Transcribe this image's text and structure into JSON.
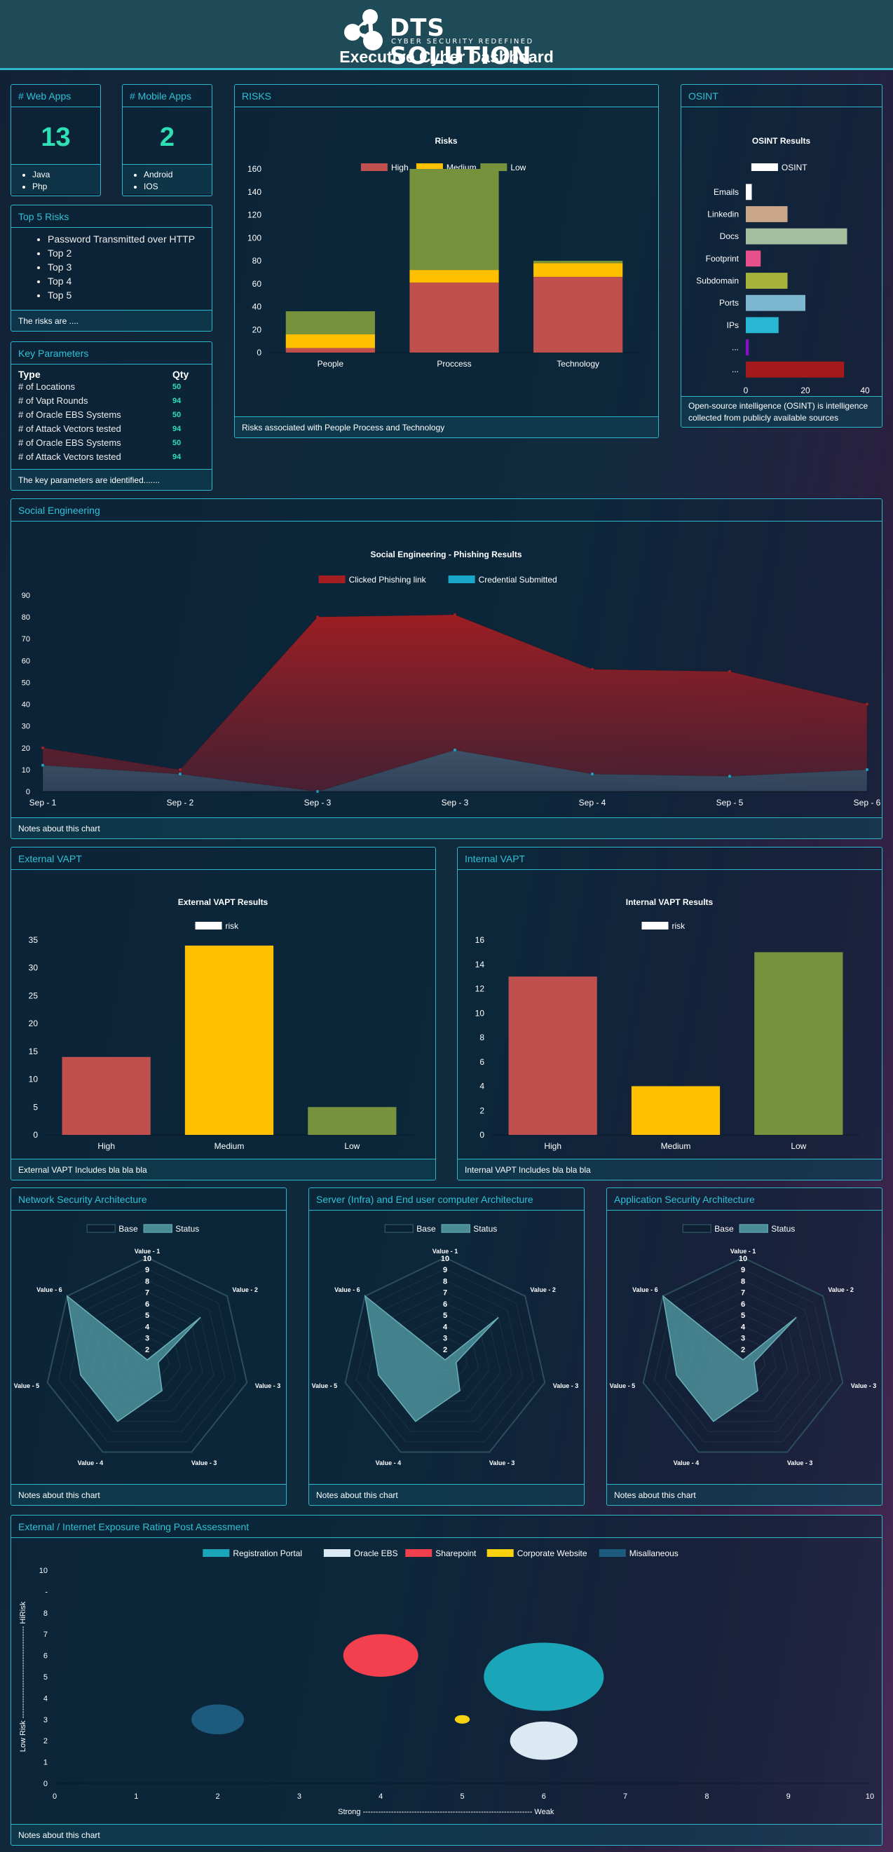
{
  "header": {
    "brand": "DTS SOLUTION",
    "tagline": "CYBER SECURITY REDEFINED",
    "title": "Executive Cyber Dashboard"
  },
  "web_apps": {
    "title": "# Web Apps",
    "count": "13",
    "items": [
      "Java",
      "Php"
    ]
  },
  "mobile_apps": {
    "title": "# Mobile Apps",
    "count": "2",
    "items": [
      "Android",
      "IOS"
    ]
  },
  "top_risks": {
    "title": "Top 5 Risks",
    "items": [
      "Password Transmitted over HTTP",
      "Top 2",
      "Top 3",
      "Top 4",
      "Top 5"
    ],
    "footer": "The risks are ...."
  },
  "key_parameters": {
    "title": "Key Parameters",
    "columns": [
      "Type",
      "Qty"
    ],
    "rows": [
      {
        "type": "# of Locations",
        "qty": "50"
      },
      {
        "type": "# of Vapt Rounds",
        "qty": "94"
      },
      {
        "type": "# of Oracle EBS Systems",
        "qty": "50"
      },
      {
        "type": "# of Attack Vectors tested",
        "qty": "94"
      },
      {
        "type": "# of Oracle EBS Systems",
        "qty": "50"
      },
      {
        "type": "# of Attack Vectors tested",
        "qty": "94"
      }
    ],
    "footer": "The key parameters are identified......."
  },
  "panels": {
    "risks": {
      "title": "RISKS",
      "footer": "Risks associated with People Process and Technology"
    },
    "osint": {
      "title": "OSINT",
      "footer_lines": [
        "Open-source intelligence (OSINT) is intelligence",
        "collected from publicly available sources"
      ]
    },
    "social": {
      "title": "Social Engineering",
      "footer": "Notes about this chart"
    },
    "ext_vapt": {
      "title": "External VAPT",
      "footer": "External VAPT Includes bla bla bla"
    },
    "int_vapt": {
      "title": "Internal VAPT",
      "footer": "Internal VAPT Includes bla bla bla"
    },
    "radar1": {
      "title": "Network Security Architecture",
      "footer": "Notes about this chart"
    },
    "radar2": {
      "title": "Server (Infra) and End user computer Architecture",
      "footer": "Notes about this chart"
    },
    "radar3": {
      "title": "Application Security Architecture",
      "footer": "Notes about this chart"
    },
    "exposure": {
      "title": "External / Internet Exposure Rating Post Assessment",
      "footer": "Notes about this chart"
    }
  },
  "chart_data": [
    {
      "id": "risks",
      "type": "bar",
      "stacked": true,
      "title": "Risks",
      "categories": [
        "People",
        "Proccess",
        "Technology"
      ],
      "series": [
        {
          "name": "High",
          "color": "#c0504d",
          "values": [
            4,
            61,
            66
          ]
        },
        {
          "name": "Medium",
          "color": "#ffc000",
          "values": [
            12,
            11,
            12
          ]
        },
        {
          "name": "Low",
          "color": "#76923c",
          "values": [
            20,
            88,
            2
          ]
        }
      ],
      "ylim": [
        0,
        160
      ],
      "yticks": [
        0,
        20,
        40,
        60,
        80,
        100,
        120,
        140,
        160
      ],
      "legend": "top"
    },
    {
      "id": "osint",
      "type": "bar",
      "orientation": "horizontal",
      "title": "OSINT Results",
      "legend_label": "OSINT",
      "categories": [
        "Emails",
        "Linkedin",
        "Docs",
        "Footprint",
        "Subdomain",
        "Ports",
        "IPs",
        "...",
        "..."
      ],
      "values": [
        2,
        14,
        34,
        5,
        14,
        20,
        11,
        1,
        33
      ],
      "colors": [
        "#ffffff",
        "#c9a58a",
        "#a3bfa0",
        "#e8508a",
        "#a6b43c",
        "#7db8d0",
        "#27b6d3",
        "#8a10c8",
        "#a41a1a"
      ],
      "xlim": [
        0,
        40
      ],
      "xticks": [
        0,
        20,
        40
      ],
      "legend": "top"
    },
    {
      "id": "social",
      "type": "area",
      "title": "Social Engineering - Phishing Results",
      "categories": [
        "Sep - 1",
        "Sep - 2",
        "Sep - 3",
        "Sep - 3",
        "Sep - 4",
        "Sep - 5",
        "Sep - 6"
      ],
      "series": [
        {
          "name": "Clicked Phishing link",
          "color": "#a41e22",
          "values": [
            20,
            10,
            80,
            81,
            56,
            55,
            40
          ]
        },
        {
          "name": "Credential Submitted",
          "color": "#1aa6c9",
          "values": [
            12,
            8,
            0,
            19,
            8,
            7,
            10
          ]
        }
      ],
      "ylim": [
        0,
        90
      ],
      "yticks": [
        0,
        10,
        20,
        30,
        40,
        50,
        60,
        70,
        80,
        90
      ],
      "legend": "top"
    },
    {
      "id": "ext_vapt",
      "type": "bar",
      "title": "External VAPT Results",
      "legend_label": "risk",
      "categories": [
        "High",
        "Medium",
        "Low"
      ],
      "values": [
        14,
        34,
        5
      ],
      "colors": [
        "#c0504d",
        "#ffc000",
        "#76923c"
      ],
      "ylim": [
        0,
        35
      ],
      "yticks": [
        0,
        5,
        10,
        15,
        20,
        25,
        30,
        35
      ],
      "legend": "top"
    },
    {
      "id": "int_vapt",
      "type": "bar",
      "title": "Internal VAPT Results",
      "legend_label": "risk",
      "categories": [
        "High",
        "Medium",
        "Low"
      ],
      "values": [
        13,
        4,
        15
      ],
      "colors": [
        "#c0504d",
        "#ffc000",
        "#76923c"
      ],
      "ylim": [
        0,
        16
      ],
      "yticks": [
        0,
        2,
        4,
        6,
        8,
        10,
        12,
        14,
        16
      ],
      "legend": "top"
    },
    {
      "id": "radar1",
      "type": "radar",
      "labels": [
        "Value - 1",
        "Value - 2",
        "Value - 3",
        "Value - 3",
        "Value - 4",
        "Value - 5",
        "Value - 6"
      ],
      "series": [
        {
          "name": "Base",
          "values": [
            10,
            10,
            10,
            10,
            10,
            10,
            10
          ]
        },
        {
          "name": "Status",
          "values": [
            1,
            7,
            2,
            4,
            7,
            7,
            10
          ]
        }
      ],
      "rticks": [
        2,
        3,
        4,
        5,
        6,
        7,
        8,
        9,
        10
      ],
      "rlim": [
        1,
        10
      ],
      "legend": "top"
    },
    {
      "id": "radar2",
      "type": "radar",
      "labels": [
        "Value - 1",
        "Value - 2",
        "Value - 3",
        "Value - 3",
        "Value - 4",
        "Value - 5",
        "Value - 6"
      ],
      "series": [
        {
          "name": "Base",
          "values": [
            10,
            10,
            10,
            10,
            10,
            10,
            10
          ]
        },
        {
          "name": "Status",
          "values": [
            1,
            7,
            2,
            4,
            7,
            7,
            10
          ]
        }
      ],
      "rticks": [
        2,
        3,
        4,
        5,
        6,
        7,
        8,
        9,
        10
      ],
      "rlim": [
        1,
        10
      ],
      "legend": "top"
    },
    {
      "id": "radar3",
      "type": "radar",
      "labels": [
        "Value - 1",
        "Value - 2",
        "Value - 3",
        "Value - 3",
        "Value - 4",
        "Value - 5",
        "Value - 6"
      ],
      "series": [
        {
          "name": "Base",
          "values": [
            10,
            10,
            10,
            10,
            10,
            10,
            10
          ]
        },
        {
          "name": "Status",
          "values": [
            1,
            7,
            2,
            4,
            7,
            7,
            10
          ]
        }
      ],
      "rticks": [
        2,
        3,
        4,
        5,
        6,
        7,
        8,
        9,
        10
      ],
      "rlim": [
        1,
        10
      ],
      "legend": "top"
    },
    {
      "id": "exposure",
      "type": "scatter",
      "subtype": "bubble",
      "series": [
        {
          "name": "Registration Portal",
          "color": "#1ba5b8",
          "x": 6,
          "y": 5,
          "r": 1.6
        },
        {
          "name": "Oracle EBS",
          "color": "#dbe9f2",
          "x": 6,
          "y": 2,
          "r": 0.9
        },
        {
          "name": "Sharepoint",
          "color": "#f2404e",
          "x": 4,
          "y": 6,
          "r": 1.0
        },
        {
          "name": "Corporate Website",
          "color": "#f8d20f",
          "x": 5,
          "y": 3,
          "r": 0.2
        },
        {
          "name": "Misallaneous",
          "color": "#1c5a7e",
          "x": 2,
          "y": 3,
          "r": 0.7
        }
      ],
      "xlim": [
        0,
        10
      ],
      "ylim": [
        0,
        10
      ],
      "xticks": [
        "0",
        "1",
        "2",
        "3",
        "4",
        "5",
        "6",
        "7",
        "8",
        "9",
        "10"
      ],
      "yticks": [
        "0",
        "1",
        "2",
        "3",
        "4",
        "5",
        "6",
        "7",
        "8",
        "-",
        "10"
      ],
      "xlabel": "Strong ------------------------------------------------------------------ Weak",
      "ylabel": "Low Risk ------------------------------------ HiRisk",
      "legend": "top"
    }
  ]
}
